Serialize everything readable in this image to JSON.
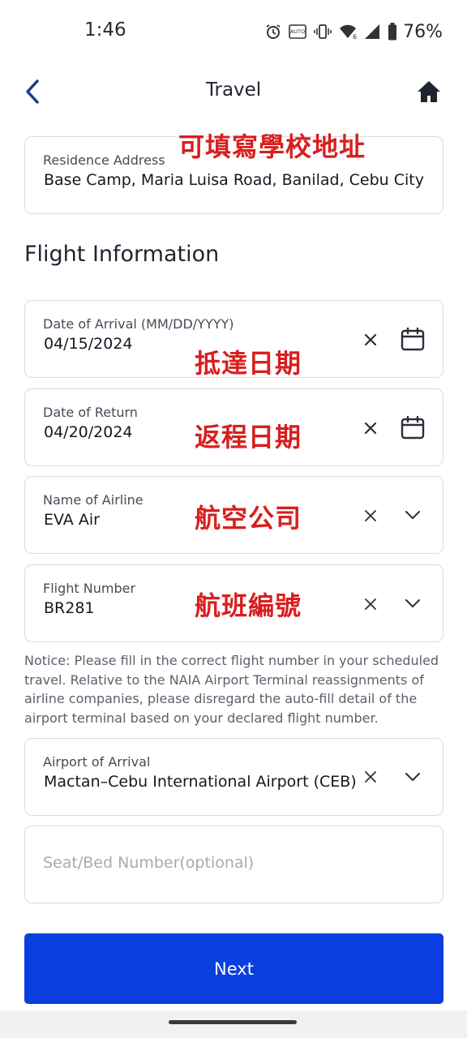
{
  "status_bar": {
    "time": "1:46",
    "battery_percent": "76%",
    "icons": [
      "alarm-icon",
      "auto-brightness-icon",
      "vibrate-icon",
      "wifi-icon",
      "signal-icon",
      "battery-icon"
    ]
  },
  "header": {
    "title": "Travel",
    "back_icon": "chevron-left-icon",
    "home_icon": "home-icon"
  },
  "residence": {
    "label": "Residence Address",
    "value": "Base Camp, Maria Luisa Road, Banilad, Cebu City",
    "annotation": "可填寫學校地址"
  },
  "section_title": "Flight Information",
  "fields": {
    "arrival_date": {
      "label": "Date of Arrival (MM/DD/YYYY)",
      "value": "04/15/2024",
      "annotation": "抵達日期"
    },
    "return_date": {
      "label": "Date of Return",
      "value": "04/20/2024",
      "annotation": "返程日期"
    },
    "airline": {
      "label": "Name of Airline",
      "value": "EVA Air",
      "annotation": "航空公司"
    },
    "flight_number": {
      "label": "Flight Number",
      "value": "BR281",
      "annotation": "航班編號"
    },
    "airport": {
      "label": "Airport of Arrival",
      "value": "Mactan–Cebu International Airport (CEB)"
    },
    "seat": {
      "placeholder": "Seat/Bed Number(optional)"
    }
  },
  "notice": "Notice: Please fill in the correct flight number in your scheduled travel. Relative to the NAIA Airport Terminal reassignments of airline companies, please disregard the auto-fill detail of the airport terminal based on your declared flight number.",
  "next_button": "Next",
  "colors": {
    "primary": "#0a3fdf",
    "annotation": "#d91e1e",
    "border": "#d9dce3"
  }
}
